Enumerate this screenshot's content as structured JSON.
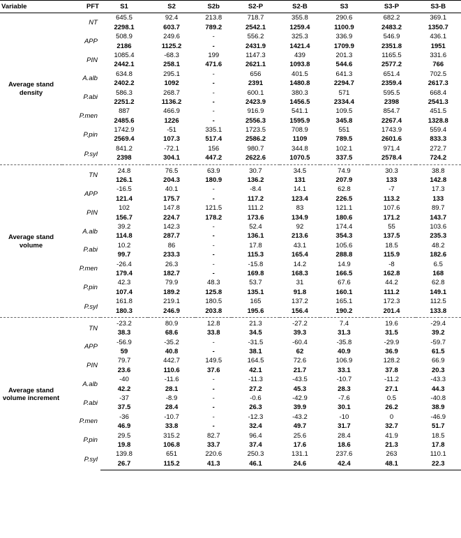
{
  "headers": [
    "Variable",
    "PFT",
    "S1",
    "S2",
    "S2b",
    "S2-P",
    "S2-B",
    "S3",
    "S3-P",
    "S3-B"
  ],
  "sections": [
    {
      "variable": "Average stand density",
      "groups": [
        {
          "pft": "NT",
          "rows": [
            [
              "645.5",
              "92.4",
              "213.8",
              "718.7",
              "355.8",
              "290.6",
              "682.2",
              "369.1"
            ],
            [
              "2298.1",
              "603.7",
              "789.2",
              "2542.1",
              "1259.4",
              "1100.9",
              "2483.2",
              "1350.7"
            ]
          ],
          "bold_row": 1
        },
        {
          "pft": "APP",
          "rows": [
            [
              "508.9",
              "249.6",
              "-",
              "556.2",
              "325.3",
              "336.9",
              "546.9",
              "436.1"
            ],
            [
              "2186",
              "1125.2",
              "-",
              "2431.9",
              "1421.4",
              "1709.9",
              "2351.8",
              "1951"
            ]
          ],
          "bold_row": 1
        },
        {
          "pft": "PIN",
          "rows": [
            [
              "1085.4",
              "-68.3",
              "199",
              "1147.3",
              "439",
              "201.3",
              "1165.5",
              "331.6"
            ],
            [
              "2442.1",
              "258.1",
              "471.6",
              "2621.1",
              "1093.8",
              "544.6",
              "2577.2",
              "766"
            ]
          ],
          "bold_row": 1
        },
        {
          "pft": "A.alb",
          "rows": [
            [
              "634.8",
              "295.1",
              "-",
              "656",
              "401.5",
              "641.3",
              "651.4",
              "702.5"
            ],
            [
              "2402.2",
              "1092",
              "-",
              "2391",
              "1480.8",
              "2294.7",
              "2359.4",
              "2617.3"
            ]
          ],
          "bold_row": 1
        },
        {
          "pft": "P.abi",
          "rows": [
            [
              "586.3",
              "268.7",
              "-",
              "600.1",
              "380.3",
              "571",
              "595.5",
              "668.4"
            ],
            [
              "2251.2",
              "1136.2",
              "-",
              "2423.9",
              "1456.5",
              "2334.4",
              "2398",
              "2541.3"
            ]
          ],
          "bold_row": 1
        },
        {
          "pft": "P.men",
          "rows": [
            [
              "887",
              "466.9",
              "-",
              "916.9",
              "541.1",
              "109.5",
              "854.7",
              "451.5"
            ],
            [
              "2485.6",
              "1226",
              "-",
              "2556.3",
              "1595.9",
              "345.8",
              "2267.4",
              "1328.8"
            ]
          ],
          "bold_row": 1
        },
        {
          "pft": "P.pin",
          "rows": [
            [
              "1742.9",
              "-51",
              "335.1",
              "1723.5",
              "708.9",
              "551",
              "1743.9",
              "559.4"
            ],
            [
              "2569.4",
              "107.3",
              "517.4",
              "2586.2",
              "1109",
              "789.5",
              "2601.6",
              "833.3"
            ]
          ],
          "bold_row": 1
        },
        {
          "pft": "P.syl",
          "rows": [
            [
              "841.2",
              "-72.1",
              "156",
              "980.7",
              "344.8",
              "102.1",
              "971.4",
              "272.7"
            ],
            [
              "2398",
              "304.1",
              "447.2",
              "2622.6",
              "1070.5",
              "337.5",
              "2578.4",
              "724.2"
            ]
          ],
          "bold_row": 1
        }
      ]
    },
    {
      "variable": "Average stand volume",
      "groups": [
        {
          "pft": "TN",
          "rows": [
            [
              "24.8",
              "76.5",
              "63.9",
              "30.7",
              "34.5",
              "74.9",
              "30.3",
              "38.8"
            ],
            [
              "126.1",
              "204.3",
              "180.9",
              "136.2",
              "131",
              "207.9",
              "133",
              "142.8"
            ]
          ],
          "bold_row": 1
        },
        {
          "pft": "APP",
          "rows": [
            [
              "-16.5",
              "40.1",
              "-",
              "-8.4",
              "14.1",
              "62.8",
              "-7",
              "17.3"
            ],
            [
              "121.4",
              "175.7",
              "-",
              "117.2",
              "123.4",
              "226.5",
              "113.2",
              "133"
            ]
          ],
          "bold_row": 1
        },
        {
          "pft": "PIN",
          "rows": [
            [
              "102",
              "147.8",
              "121.5",
              "111.2",
              "83",
              "121.1",
              "107.6",
              "89.7"
            ],
            [
              "156.7",
              "224.7",
              "178.2",
              "173.6",
              "134.9",
              "180.6",
              "171.2",
              "143.7"
            ]
          ],
          "bold_row": 1
        },
        {
          "pft": "A.alb",
          "rows": [
            [
              "39.2",
              "142.3",
              "-",
              "52.4",
              "92",
              "174.4",
              "55",
              "103.6"
            ],
            [
              "114.8",
              "287.7",
              "-",
              "136.1",
              "213.6",
              "354.3",
              "137.5",
              "235.3"
            ]
          ],
          "bold_row": 1
        },
        {
          "pft": "P.abi",
          "rows": [
            [
              "10.2",
              "86",
              "-",
              "17.8",
              "43.1",
              "105.6",
              "18.5",
              "48.2"
            ],
            [
              "99.7",
              "233.3",
              "-",
              "115.3",
              "165.4",
              "288.8",
              "115.9",
              "182.6"
            ]
          ],
          "bold_row": 1
        },
        {
          "pft": "P.men",
          "rows": [
            [
              "-26.4",
              "26.3",
              "-",
              "-15.8",
              "14.2",
              "14.9",
              "-8",
              "6.5"
            ],
            [
              "179.4",
              "182.7",
              "-",
              "169.8",
              "168.3",
              "166.5",
              "162.8",
              "168"
            ]
          ],
          "bold_row": 1
        },
        {
          "pft": "P.pin",
          "rows": [
            [
              "42.3",
              "79.9",
              "48.3",
              "53.7",
              "31",
              "67.6",
              "44.2",
              "62.8"
            ],
            [
              "107.4",
              "189.2",
              "125.8",
              "135.1",
              "91.8",
              "160.1",
              "111.2",
              "149.1"
            ]
          ],
          "bold_row": 1
        },
        {
          "pft": "P.syl",
          "rows": [
            [
              "161.8",
              "219.1",
              "180.5",
              "165",
              "137.2",
              "165.1",
              "172.3",
              "112.5"
            ],
            [
              "180.3",
              "246.9",
              "203.8",
              "195.6",
              "156.4",
              "190.2",
              "201.4",
              "133.8"
            ]
          ],
          "bold_row": 1
        }
      ]
    },
    {
      "variable": "Average stand volume increment",
      "groups": [
        {
          "pft": "TN",
          "rows": [
            [
              "-23.2",
              "80.9",
              "12.8",
              "21.3",
              "-27.2",
              "7.4",
              "19.6",
              "-29.4"
            ],
            [
              "38.3",
              "68.6",
              "33.8",
              "34.5",
              "39.3",
              "31.3",
              "31.5",
              "39.2"
            ]
          ],
          "bold_row": 1
        },
        {
          "pft": "APP",
          "rows": [
            [
              "-56.9",
              "-35.2",
              "-",
              "-31.5",
              "-60.4",
              "-35.8",
              "-29.9",
              "-59.7"
            ],
            [
              "59",
              "40.8",
              "-",
              "38.1",
              "62",
              "40.9",
              "36.9",
              "61.5"
            ]
          ],
          "bold_row": 1
        },
        {
          "pft": "PIN",
          "rows": [
            [
              "79.7",
              "442.7",
              "149.5",
              "164.5",
              "72.6",
              "106.9",
              "128.2",
              "66.9"
            ],
            [
              "23.6",
              "110.6",
              "37.6",
              "42.1",
              "21.7",
              "33.1",
              "37.8",
              "20.3"
            ]
          ],
          "bold_row": 1
        },
        {
          "pft": "A.alb",
          "rows": [
            [
              "-40",
              "-11.6",
              "-",
              "-11.3",
              "-43.5",
              "-10.7",
              "-11.2",
              "-43.3"
            ],
            [
              "42.2",
              "28.1",
              "-",
              "27.2",
              "45.3",
              "28.3",
              "27.1",
              "44.3"
            ]
          ],
          "bold_row": 1
        },
        {
          "pft": "P.abi",
          "rows": [
            [
              "-37",
              "-8.9",
              "-",
              "-0.6",
              "-42.9",
              "-7.6",
              "0.5",
              "-40.8"
            ],
            [
              "37.5",
              "28.4",
              "-",
              "26.3",
              "39.9",
              "30.1",
              "26.2",
              "38.9"
            ]
          ],
          "bold_row": 1
        },
        {
          "pft": "P.men",
          "rows": [
            [
              "-36",
              "-10.7",
              "-",
              "-12.3",
              "-43.2",
              "-10",
              "0",
              "-46.9"
            ],
            [
              "46.9",
              "33.8",
              "-",
              "32.4",
              "49.7",
              "31.7",
              "32.7",
              "51.7"
            ]
          ],
          "bold_row": 1
        },
        {
          "pft": "P.pin",
          "rows": [
            [
              "29.5",
              "315.2",
              "82.7",
              "96.4",
              "25.6",
              "28.4",
              "41.9",
              "18.5"
            ],
            [
              "19.8",
              "106.8",
              "33.7",
              "37.4",
              "17.6",
              "18.6",
              "21.3",
              "17.8"
            ]
          ],
          "bold_row": 1
        },
        {
          "pft": "P.syl",
          "rows": [
            [
              "139.8",
              "651",
              "220.6",
              "250.3",
              "131.1",
              "237.6",
              "263",
              "110.1"
            ],
            [
              "26.7",
              "115.2",
              "41.3",
              "46.1",
              "24.6",
              "42.4",
              "48.1",
              "22.3"
            ]
          ],
          "bold_row": 1
        }
      ]
    }
  ]
}
